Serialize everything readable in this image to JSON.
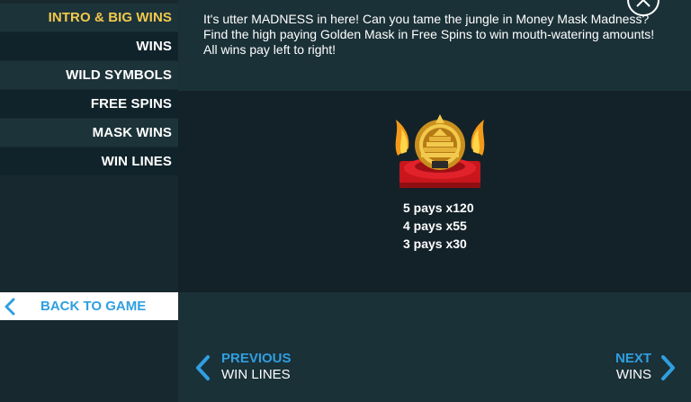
{
  "sidebar": {
    "items": [
      {
        "label": "INTRO & BIG WINS"
      },
      {
        "label": "WINS"
      },
      {
        "label": "WILD SYMBOLS"
      },
      {
        "label": "FREE SPINS"
      },
      {
        "label": "MASK WINS"
      },
      {
        "label": "WIN LINES"
      }
    ],
    "back_label": "BACK TO GAME"
  },
  "content": {
    "lines": [
      "It's utter MADNESS in here! Can you tame the jungle in Money Mask Madness?",
      "Find the high paying Golden Mask in Free Spins to win mouth-watering amounts!",
      "All wins pay left to right!"
    ],
    "symbol_icon": "golden-mask-icon",
    "pays": [
      "5 pays x120",
      "4 pays x55",
      "3 pays x30"
    ]
  },
  "nav": {
    "prev_title": "PREVIOUS",
    "prev_sub": "WIN LINES",
    "next_title": "NEXT",
    "next_sub": "WINS"
  },
  "colors": {
    "accent_blue": "#2f9fe0",
    "active_yellow": "#f2c94c",
    "background": "#162b31"
  }
}
